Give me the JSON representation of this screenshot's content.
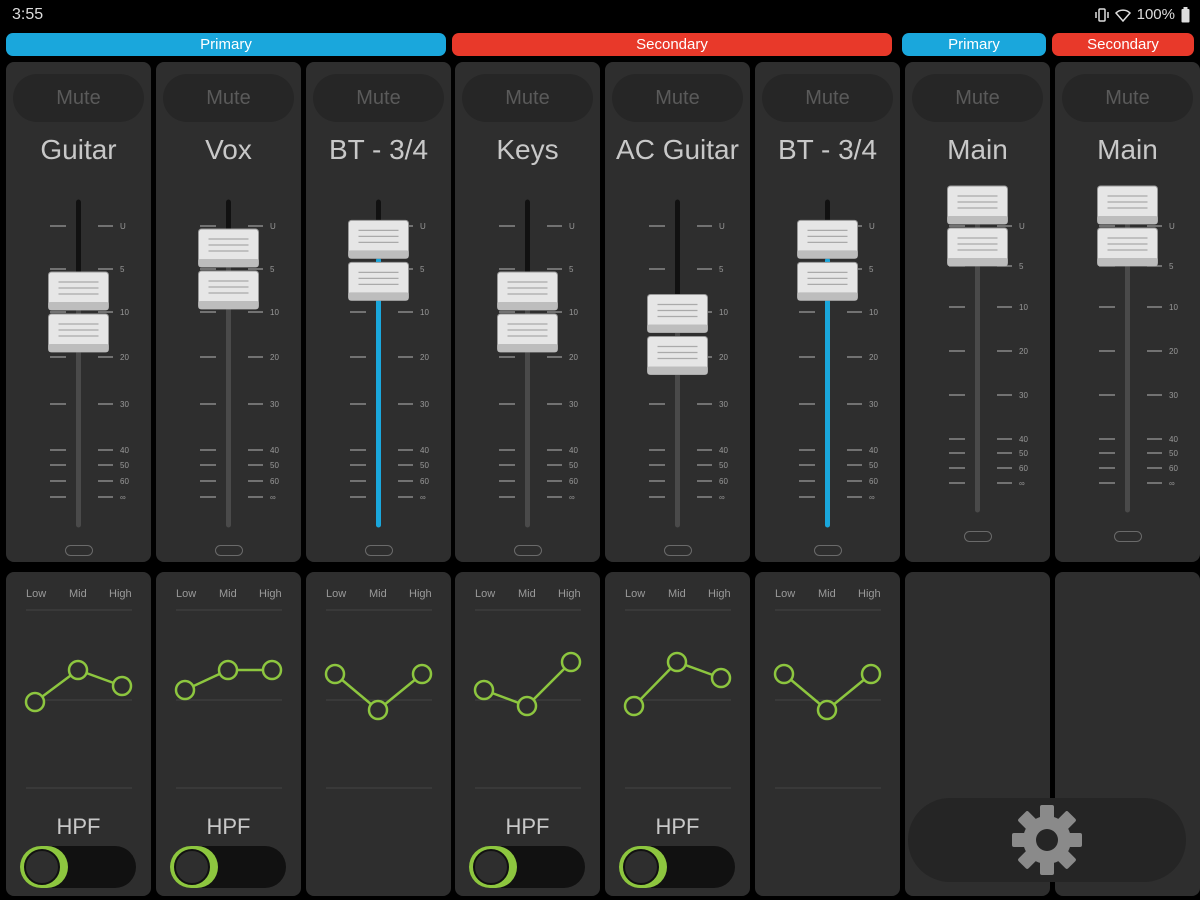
{
  "status_bar": {
    "time": "3:55",
    "battery": "100%"
  },
  "groups": [
    {
      "label": "Primary",
      "color": "#1aa7dc"
    },
    {
      "label": "Secondary",
      "color": "#e8392a"
    },
    {
      "label": "Primary",
      "color": "#1aa7dc"
    },
    {
      "label": "Secondary",
      "color": "#e8392a"
    }
  ],
  "scale_labels": [
    "U",
    "5",
    "10",
    "20",
    "30",
    "40",
    "50",
    "60",
    "∞"
  ],
  "channels": [
    {
      "name": "Guitar",
      "mute_label": "Mute",
      "fader_level_db": 10,
      "linked": false,
      "eq": {
        "low": 0.35,
        "mid": 0.75,
        "high": 0.55
      },
      "hpf": {
        "label": "HPF",
        "on": true
      }
    },
    {
      "name": "Vox",
      "mute_label": "Mute",
      "fader_level_db": 5,
      "linked": false,
      "eq": {
        "low": 0.5,
        "mid": 0.75,
        "high": 0.75
      },
      "hpf": {
        "label": "HPF",
        "on": true
      }
    },
    {
      "name": "BT - 3/4",
      "mute_label": "Mute",
      "fader_level_db": 4,
      "linked": true,
      "eq": {
        "low": 0.7,
        "mid": 0.25,
        "high": 0.7
      },
      "hpf": null
    },
    {
      "name": "Keys",
      "mute_label": "Mute",
      "fader_level_db": 10,
      "linked": false,
      "eq": {
        "low": 0.5,
        "mid": 0.3,
        "high": 0.85
      },
      "hpf": {
        "label": "HPF",
        "on": true
      }
    },
    {
      "name": "AC Guitar",
      "mute_label": "Mute",
      "fader_level_db": 15,
      "linked": false,
      "eq": {
        "low": 0.3,
        "mid": 0.85,
        "high": 0.65
      },
      "hpf": {
        "label": "HPF",
        "on": true
      }
    },
    {
      "name": "BT - 3/4",
      "mute_label": "Mute",
      "fader_level_db": 4,
      "linked": true,
      "eq": {
        "low": 0.7,
        "mid": 0.25,
        "high": 0.7
      },
      "hpf": null
    }
  ],
  "masters": [
    {
      "name": "Main",
      "mute_label": "Mute",
      "fader_level_db": 0
    },
    {
      "name": "Main",
      "mute_label": "Mute",
      "fader_level_db": 0
    }
  ],
  "eq_band_labels": [
    "Low",
    "Mid",
    "High"
  ],
  "colors": {
    "eq_curve": "#8dc63f",
    "link_meter": "#1aa7dc",
    "strip_bg": "#2e2e2e"
  },
  "settings": {
    "icon": "gear-icon"
  }
}
